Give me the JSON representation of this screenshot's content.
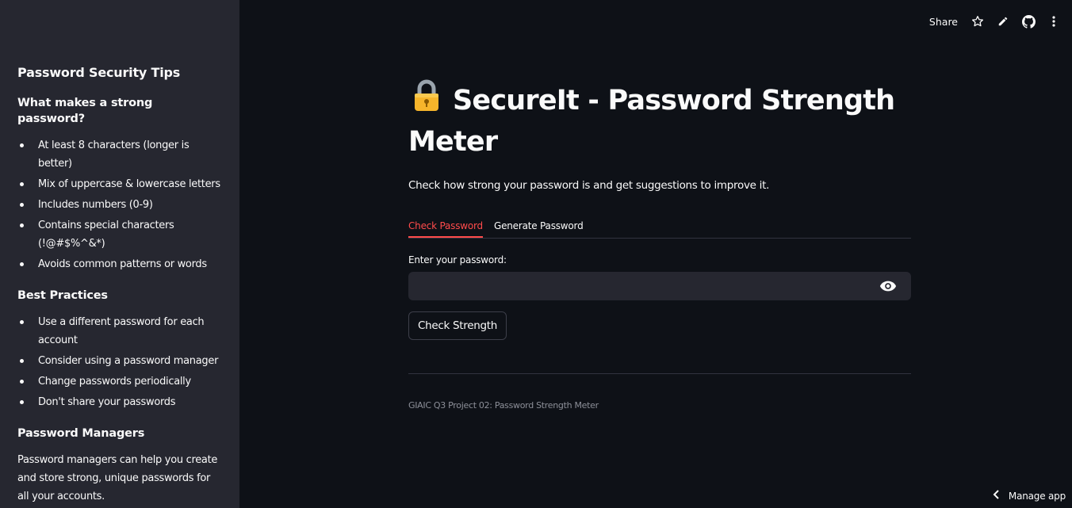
{
  "toolbar": {
    "share_label": "Share",
    "icons": [
      "star-icon",
      "pencil-icon",
      "github-icon",
      "kebab-menu-icon"
    ]
  },
  "sidebar": {
    "heading": "Password Security Tips",
    "section1": {
      "heading": "What makes a strong password?",
      "items": [
        "At least 8 characters (longer is better)",
        "Mix of uppercase & lowercase letters",
        "Includes numbers (0-9)",
        "Contains special characters (!@#$%^&*)",
        "Avoids common patterns or words"
      ]
    },
    "section2": {
      "heading": "Best Practices",
      "items": [
        "Use a different password for each account",
        "Consider using a password manager",
        "Change passwords periodically",
        "Don't share your passwords"
      ]
    },
    "section3": {
      "heading": "Password Managers",
      "text": "Password managers can help you create and store strong, unique passwords for all your accounts."
    }
  },
  "main": {
    "title_emoji": "🔐",
    "title": "SecureIt - Password Strength Meter",
    "subtitle": "Check how strong your password is and get suggestions to improve it.",
    "tabs": [
      {
        "label": "Check Password",
        "active": true
      },
      {
        "label": "Generate Password",
        "active": false
      }
    ],
    "password_label": "Enter your password:",
    "password_value": "",
    "check_button": "Check Strength",
    "footer": "GIAIC Q3 Project 02: Password Strength Meter"
  },
  "manage_app": {
    "label": "Manage app"
  },
  "colors": {
    "background": "#0e1117",
    "sidebar": "#262730",
    "accent": "#ff4b4b",
    "text": "#fafafa",
    "muted": "#8c8f98"
  }
}
